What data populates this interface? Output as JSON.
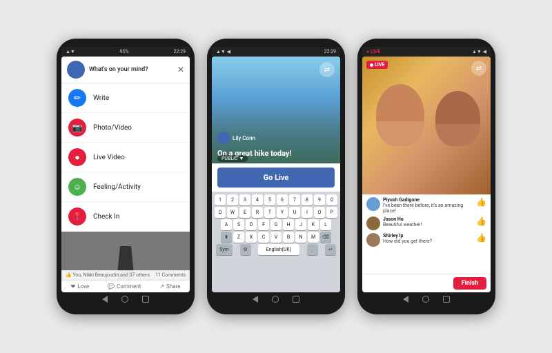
{
  "background": "#e8e8e8",
  "phone1": {
    "statusbar": {
      "signal": "▲▼",
      "battery": "95%",
      "time": "22:29"
    },
    "header": {
      "placeholder": "What's on your mind?",
      "close": "✕"
    },
    "menu": [
      {
        "id": "write",
        "label": "Write",
        "color": "#1877F2",
        "icon": "✏️"
      },
      {
        "id": "photo-video",
        "label": "Photo/Video",
        "color": "#e41e3f",
        "icon": "📷"
      },
      {
        "id": "live-video",
        "label": "Live Video",
        "color": "#e41e3f",
        "icon": "👤"
      },
      {
        "id": "feeling-activity",
        "label": "Feeling/Activity",
        "color": "#4CAF50",
        "icon": "😊"
      },
      {
        "id": "check-in",
        "label": "Check In",
        "color": "#e41e3f",
        "icon": "📍"
      }
    ],
    "reactions": {
      "left": "👍 You, Nikki Beaujoudin and 37 others",
      "right": "11 Comments"
    },
    "actions": [
      "Love",
      "Comment",
      "Share"
    ]
  },
  "phone2": {
    "statusbar": {
      "time": "22:29"
    },
    "camera_caption": "On a great hike today!",
    "username": "Lily Conn",
    "public_label": "PUBLIC",
    "go_live_label": "Go Live",
    "keyboard_rows": [
      [
        "1",
        "2",
        "3",
        "4",
        "5",
        "6",
        "7",
        "8",
        "9",
        "0"
      ],
      [
        "Q",
        "W",
        "E",
        "R",
        "T",
        "Y",
        "U",
        "I",
        "O",
        "P"
      ],
      [
        "A",
        "S",
        "D",
        "F",
        "G",
        "H",
        "J",
        "K",
        "L"
      ],
      [
        "Z",
        "X",
        "C",
        "V",
        "B",
        "N",
        "M"
      ]
    ],
    "key_sym": "Sym",
    "key_lang": "English(UK)"
  },
  "phone3": {
    "statusbar": {
      "live_label": "Live",
      "time": ""
    },
    "live_badge": "LIVE",
    "comments": [
      {
        "name": "Piyush Gadigone",
        "text": "I've been there before, it's an amazing place!"
      },
      {
        "name": "Jason Hu",
        "text": "Beautiful weather!"
      },
      {
        "name": "Shirley Ip",
        "text": "How did you get there?"
      }
    ],
    "finish_label": "Finish"
  }
}
